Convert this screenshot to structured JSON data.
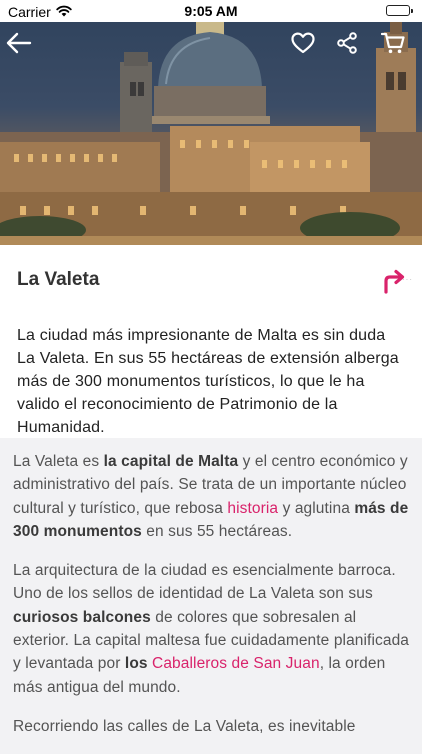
{
  "status_bar": {
    "carrier": "Carrier",
    "time": "9:05 AM"
  },
  "hero": {
    "icons": [
      "back-arrow-icon",
      "heart-icon",
      "share-icon",
      "cart-icon"
    ]
  },
  "place": {
    "title": "La Valeta",
    "more": "···"
  },
  "intro": "La ciudad más impresionante de Malta es sin duda La Valeta. En sus 55 hectáreas de extensión alberga más de 300 monumentos turísticos, lo que le ha valido el reconocimiento de Patrimonio de la Humanidad.",
  "article": {
    "p1": {
      "t1": "La Valeta es ",
      "b1": "la capital de Malta",
      "t2": " y el centro económico y administrativo del país. Se trata de un importante núcleo cultural y turístico, que rebosa ",
      "link1": "historia",
      "t3": " y aglutina ",
      "b2": "más de 300 monumentos",
      "t4": " en sus 55 hectáreas."
    },
    "p2": {
      "t1": "La arquitectura de la ciudad es esencialmente barroca. Uno de los sellos de identidad de La Valeta son sus ",
      "b1": "curiosos balcones",
      "t2": " de colores que sobresalen al exterior. La capital maltesa fue cuidadamente planificada y levantada por ",
      "b2": "los",
      "t3": " ",
      "link1": "Caballeros de San Juan",
      "t4": ", la orden más antigua del mundo."
    },
    "p3": {
      "t1": "Recorriendo las calles de La Valeta, es inevitable"
    }
  },
  "colors": {
    "accent": "#d9236b",
    "icon_white": "#ffffff"
  }
}
